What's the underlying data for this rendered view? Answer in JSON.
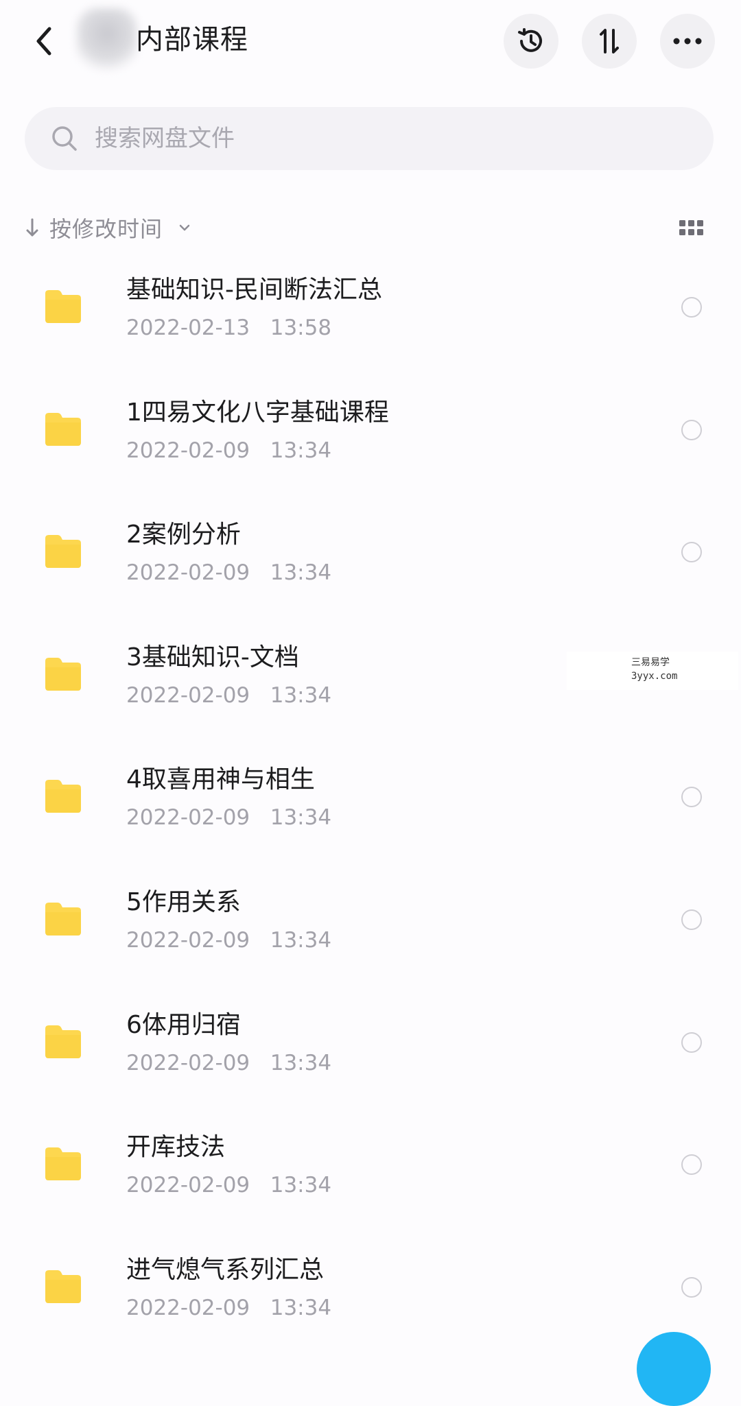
{
  "header": {
    "title": "内部课程",
    "back_icon": "chevron-left-icon",
    "actions": [
      {
        "name": "history",
        "icon": "history-icon"
      },
      {
        "name": "sort",
        "icon": "sort-arrows-icon"
      },
      {
        "name": "more",
        "icon": "more-horizontal-icon"
      }
    ]
  },
  "search": {
    "placeholder": "搜索网盘文件",
    "value": ""
  },
  "sort_bar": {
    "label": "按修改时间",
    "view_icon": "grid-view-icon"
  },
  "files": [
    {
      "name": "基础知识-民间断法汇总",
      "modified": "2022-02-13   13:58",
      "type": "folder"
    },
    {
      "name": "1四易文化八字基础课程",
      "modified": "2022-02-09   13:34",
      "type": "folder"
    },
    {
      "name": "2案例分析",
      "modified": "2022-02-09   13:34",
      "type": "folder"
    },
    {
      "name": "3基础知识-文档",
      "modified": "2022-02-09   13:34",
      "type": "folder"
    },
    {
      "name": "4取喜用神与相生",
      "modified": "2022-02-09   13:34",
      "type": "folder"
    },
    {
      "name": "5作用关系",
      "modified": "2022-02-09   13:34",
      "type": "folder"
    },
    {
      "name": "6体用归宿",
      "modified": "2022-02-09   13:34",
      "type": "folder"
    },
    {
      "name": "开库技法",
      "modified": "2022-02-09   13:34",
      "type": "folder"
    },
    {
      "name": "进气熄气系列汇总",
      "modified": "2022-02-09   13:34",
      "type": "folder"
    }
  ],
  "watermark": {
    "line1": "三易易学",
    "line2": "3yyx.com"
  },
  "colors": {
    "folder": "#fdd74f",
    "accent": "#21b6f4",
    "muted_text": "#a3a2aa"
  }
}
